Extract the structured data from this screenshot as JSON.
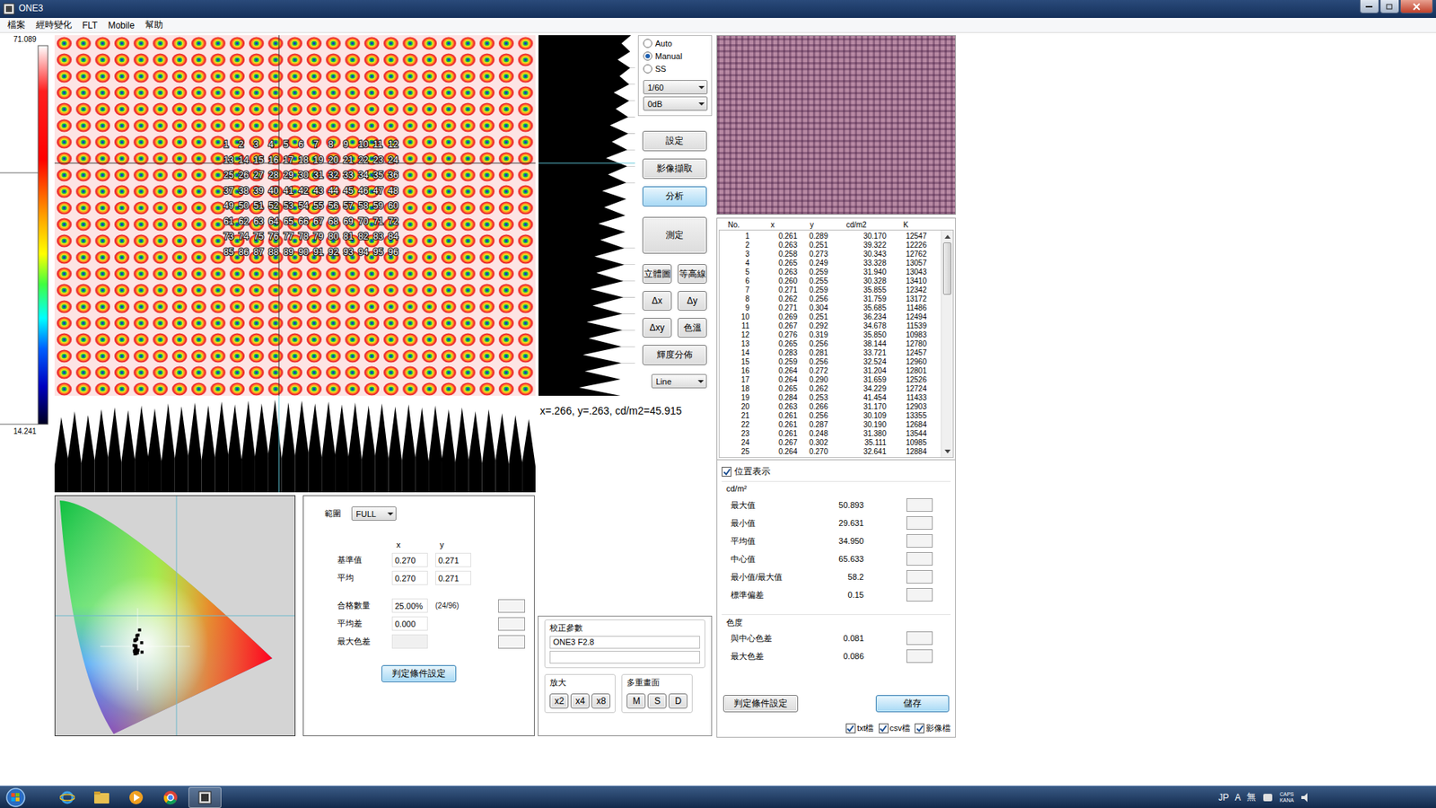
{
  "window": {
    "title": "ONE3"
  },
  "menu": [
    "檔案",
    "經時變化",
    "FLT",
    "Mobile",
    "幫助"
  ],
  "scale": {
    "max": "71.089",
    "min": "14.241"
  },
  "heatmap": {
    "labels": [
      "1",
      "2",
      "3",
      "4",
      "5",
      "6",
      "7",
      "8",
      "9",
      "10",
      "11",
      "12",
      "13",
      "14",
      "15",
      "16",
      "17",
      "18",
      "19",
      "20",
      "21",
      "22",
      "23",
      "24",
      "25",
      "26",
      "27",
      "28",
      "29",
      "30",
      "31",
      "32",
      "33",
      "34",
      "35",
      "36",
      "37",
      "38",
      "39",
      "40",
      "41",
      "42",
      "43",
      "44",
      "45",
      "46",
      "47",
      "48",
      "49",
      "50",
      "51",
      "52",
      "53",
      "54",
      "55",
      "56",
      "57",
      "58",
      "59",
      "60",
      "61",
      "62",
      "63",
      "64",
      "65",
      "66",
      "67",
      "68",
      "69",
      "70",
      "71",
      "72",
      "73",
      "74",
      "75",
      "76",
      "77",
      "78",
      "79",
      "80",
      "81",
      "82",
      "83",
      "84",
      "85",
      "86",
      "87",
      "88",
      "89",
      "90",
      "91",
      "92",
      "93",
      "94",
      "95",
      "96"
    ]
  },
  "profiles": {
    "horizontal": {
      "peaks": [
        78,
        84,
        80,
        86,
        88,
        85,
        90,
        87,
        92,
        89,
        93,
        90,
        94,
        91,
        95,
        92,
        96,
        93,
        95,
        92,
        94,
        91,
        93,
        90,
        92,
        89,
        91,
        88,
        90,
        86,
        88,
        84,
        86,
        82,
        80,
        76
      ],
      "valleys": [
        28,
        35,
        30,
        33,
        36,
        31,
        34,
        37,
        32,
        35,
        38,
        33,
        36,
        39,
        34,
        37,
        40,
        35,
        38,
        41,
        36,
        39,
        37,
        34,
        38,
        35,
        33,
        36,
        32,
        35,
        31,
        34,
        30,
        33,
        29,
        31,
        27
      ]
    },
    "vertical": {
      "peaks": [
        14,
        18,
        16,
        22,
        20,
        26,
        24,
        30,
        28,
        34,
        32,
        38,
        36,
        42,
        40,
        46,
        44,
        50,
        48,
        54,
        52,
        58
      ],
      "valleys": [
        4,
        5,
        5,
        6,
        6,
        7,
        7,
        8,
        8,
        9,
        9,
        10,
        10,
        11,
        11,
        12,
        12,
        13,
        13,
        14,
        14,
        15,
        15
      ]
    }
  },
  "exposure": {
    "modes": [
      {
        "label": "Auto",
        "selected": false
      },
      {
        "label": "Manual",
        "selected": true
      },
      {
        "label": "SS",
        "selected": false
      }
    ],
    "shutter": "1/60",
    "gain": "0dB"
  },
  "actions": [
    {
      "label": "設定",
      "kind": "wide",
      "selected": false
    },
    {
      "label": "影像擷取",
      "kind": "wide",
      "selected": false
    },
    {
      "label": "分析",
      "kind": "wide",
      "selected": true
    },
    {
      "label": "測定",
      "kind": "tall",
      "selected": false
    },
    {
      "label": "立體圖",
      "kind": "half",
      "selected": false
    },
    {
      "label": "等高線",
      "kind": "half",
      "selected": false
    },
    {
      "label": "Δx",
      "kind": "half",
      "selected": false
    },
    {
      "label": "Δy",
      "kind": "half",
      "selected": false
    },
    {
      "label": "Δxy",
      "kind": "half",
      "selected": false
    },
    {
      "label": "色溫",
      "kind": "half",
      "selected": false
    },
    {
      "label": "輝度分佈",
      "kind": "wide",
      "selected": false
    }
  ],
  "view_mode": "Line",
  "readout": "x=.266, y=.263, cd/m2=45.915",
  "table": {
    "columns": [
      "No.",
      "x",
      "y",
      "cd/m2",
      "K"
    ],
    "rows": [
      [
        "1",
        "0.261",
        "0.289",
        "30.170",
        "12547"
      ],
      [
        "2",
        "0.263",
        "0.251",
        "39.322",
        "12226"
      ],
      [
        "3",
        "0.258",
        "0.273",
        "30.343",
        "12762"
      ],
      [
        "4",
        "0.265",
        "0.249",
        "33.328",
        "13057"
      ],
      [
        "5",
        "0.263",
        "0.259",
        "31.940",
        "13043"
      ],
      [
        "6",
        "0.260",
        "0.255",
        "30.328",
        "13410"
      ],
      [
        "7",
        "0.271",
        "0.259",
        "35.855",
        "12342"
      ],
      [
        "8",
        "0.262",
        "0.256",
        "31.759",
        "13172"
      ],
      [
        "9",
        "0.271",
        "0.304",
        "35.685",
        "11486"
      ],
      [
        "10",
        "0.269",
        "0.251",
        "36.234",
        "12494"
      ],
      [
        "11",
        "0.267",
        "0.292",
        "34.678",
        "11539"
      ],
      [
        "12",
        "0.276",
        "0.319",
        "35.850",
        "10983"
      ],
      [
        "13",
        "0.265",
        "0.256",
        "38.144",
        "12780"
      ],
      [
        "14",
        "0.283",
        "0.281",
        "33.721",
        "12457"
      ],
      [
        "15",
        "0.259",
        "0.256",
        "32.524",
        "12960"
      ],
      [
        "16",
        "0.264",
        "0.272",
        "31.204",
        "12801"
      ],
      [
        "17",
        "0.264",
        "0.290",
        "31.659",
        "12526"
      ],
      [
        "18",
        "0.265",
        "0.262",
        "34.229",
        "12724"
      ],
      [
        "19",
        "0.284",
        "0.253",
        "41.454",
        "11433"
      ],
      [
        "20",
        "0.263",
        "0.266",
        "31.170",
        "12903"
      ],
      [
        "21",
        "0.261",
        "0.256",
        "30.109",
        "13355"
      ],
      [
        "22",
        "0.261",
        "0.287",
        "30.190",
        "12684"
      ],
      [
        "23",
        "0.261",
        "0.248",
        "31.380",
        "13544"
      ],
      [
        "24",
        "0.267",
        "0.302",
        "35.111",
        "10985"
      ],
      [
        "25",
        "0.264",
        "0.270",
        "32.641",
        "12884"
      ]
    ],
    "scroll": {
      "start": 0,
      "share": 0.26
    }
  },
  "position_display": {
    "label": "位置表示",
    "checked": true
  },
  "luminance": {
    "title": "cd/m²",
    "stats": [
      {
        "label": "最大值",
        "value": "50.893"
      },
      {
        "label": "最小值",
        "value": "29.631"
      },
      {
        "label": "平均值",
        "value": "34.950"
      },
      {
        "label": "中心值",
        "value": "65.633"
      },
      {
        "label": "最小值/最大值",
        "value": "58.2"
      },
      {
        "label": "標準偏差",
        "value": "0.15"
      }
    ]
  },
  "chromaticity": {
    "title": "色度",
    "stats": [
      {
        "label": "與中心色差",
        "value": "0.081"
      },
      {
        "label": "最大色差",
        "value": "0.086"
      }
    ]
  },
  "right_buttons": [
    {
      "label": "判定條件設定",
      "selected": false
    },
    {
      "label": "儲存",
      "selected": true
    }
  ],
  "save_options": [
    {
      "label": "txt檔",
      "checked": true
    },
    {
      "label": "csv檔",
      "checked": true
    },
    {
      "label": "影像檔",
      "checked": true
    }
  ],
  "judgment": {
    "range_label": "範圍",
    "range": "FULL",
    "headers": [
      "x",
      "y"
    ],
    "rows": [
      {
        "label": "基準值",
        "x": "0.270",
        "y": "0.271"
      },
      {
        "label": "平均",
        "x": "0.270",
        "y": "0.271"
      }
    ],
    "results": [
      {
        "label": "合格數量",
        "value": "25.00%",
        "note": "(24/96)",
        "disabled": false
      },
      {
        "label": "平均差",
        "value": "0.000",
        "note": "",
        "disabled": false
      },
      {
        "label": "最大色差",
        "value": "",
        "note": "",
        "disabled": true
      }
    ],
    "button": "判定條件設定"
  },
  "calibration": {
    "title": "校正參數",
    "fields": [
      "ONE3 F2.8",
      ""
    ]
  },
  "zoom": {
    "title": "放大",
    "buttons": [
      "x2",
      "x4",
      "x8"
    ]
  },
  "multi_screen": {
    "title": "多重畫面",
    "buttons": [
      "M",
      "S",
      "D"
    ]
  },
  "taskbar": {
    "tray": [
      "JP",
      "A",
      "無"
    ],
    "indicators": [
      "CAPS",
      "KANA"
    ]
  }
}
